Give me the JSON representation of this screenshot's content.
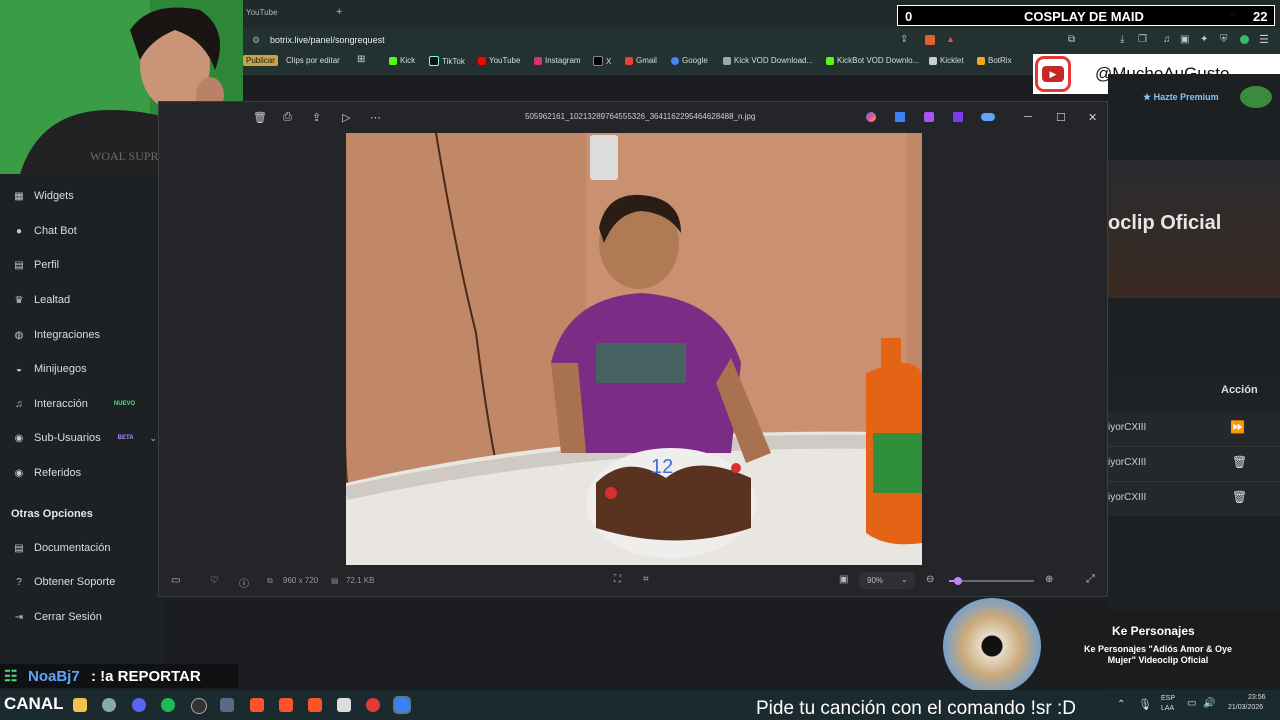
{
  "browser": {
    "tab_title": "YouTube",
    "new_tab_symbol": "+",
    "url": "botrix.live/panel/songrequest",
    "bookmarks": [
      "Publicar",
      "Clips por editar",
      "Kick",
      "TikTok",
      "YouTube",
      "Instagram",
      "X",
      "Gmail",
      "Google",
      "Kick VOD Download...",
      "KickBot VOD Downlo...",
      "Kicklet",
      "BotRix"
    ]
  },
  "overlay": {
    "counter_left": "0",
    "goal_title": "COSPLAY DE MAID",
    "counter_right": "22",
    "youtube_handle": "@MuchoAuGusto",
    "premium": "Hazte Premium",
    "song_heading_partial": "oclip Oficial"
  },
  "sidebar": {
    "items": [
      {
        "label": "Widgets",
        "icon": "widgets-icon",
        "glyph": "▦"
      },
      {
        "label": "Chat Bot",
        "icon": "robot-icon",
        "glyph": "●"
      },
      {
        "label": "Perfil",
        "icon": "profile-card-icon",
        "glyph": "▤"
      },
      {
        "label": "Lealtad",
        "icon": "trophy-icon",
        "glyph": "♛"
      },
      {
        "label": "Integraciones",
        "icon": "integrations-icon",
        "glyph": "◍"
      },
      {
        "label": "Minijuegos",
        "icon": "gamepad-icon",
        "glyph": "◒"
      },
      {
        "label": "Interacción",
        "icon": "music-note-icon",
        "glyph": "♫"
      },
      {
        "label": "Sub-Usuarios",
        "icon": "users-icon",
        "glyph": "◉"
      },
      {
        "label": "Referidos",
        "icon": "referrals-icon",
        "glyph": "◉"
      }
    ],
    "badge_new": "NUEVO",
    "badge_beta": "BETA",
    "section_title": "Otras Opciones",
    "other_items": [
      {
        "label": "Documentación",
        "icon": "document-icon",
        "glyph": "▤"
      },
      {
        "label": "Obtener Soporte",
        "icon": "help-icon",
        "glyph": "?"
      },
      {
        "label": "Cerrar Sesión",
        "icon": "logout-icon",
        "glyph": "⇥"
      }
    ]
  },
  "queue": {
    "action_header": "Acción",
    "rows": [
      "iyorCXIII",
      "iyorCXIII",
      "iyorCXIII"
    ]
  },
  "viewer": {
    "filename": "505962161_10213289764555326_3641162295464628488_n.jpg",
    "dimensions": "960 x 720",
    "file_size": "72.1 KB",
    "zoom": "90%",
    "zoom_fraction": 0.1
  },
  "now_playing": {
    "artist": "Ke Personajes",
    "title": "Ke Personajes \"Adiós Amor & Oye Mujer\" Videoclip Oficial"
  },
  "chat": {
    "username": "NoaBj7",
    "message": ": !a REPORTAR"
  },
  "bottom_bar": {
    "canal": "CANAL",
    "ticker": "Pide tu canción con el comando !sr :D",
    "lang_top": "ESP",
    "lang_bottom": "LAA",
    "time": "23:56",
    "date": "21/03/2026"
  }
}
